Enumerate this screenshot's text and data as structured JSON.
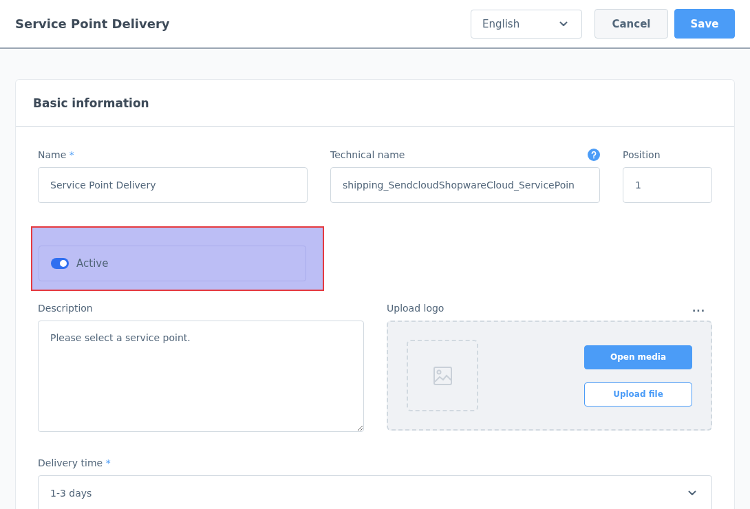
{
  "header": {
    "title": "Service Point Delivery",
    "language": "English",
    "buttons": [
      {
        "label": "Cancel",
        "kind": "secondary"
      },
      {
        "label": "Save",
        "kind": "primary"
      }
    ]
  },
  "card": {
    "title": "Basic information",
    "fields": [
      {
        "label": "Name",
        "required_mark": "*",
        "help": false,
        "value": "Service Point Delivery"
      },
      {
        "label": "Technical name",
        "help": true,
        "value": "shipping_SendcloudShopwareCloud_ServicePoin"
      },
      {
        "label": "Position",
        "help": false,
        "value": "1"
      }
    ],
    "active_switch": {
      "label": "Active",
      "on": true,
      "highlighted": true
    },
    "description": {
      "label": "Description",
      "value": "Please select a service point."
    },
    "upload": {
      "label": "Upload logo",
      "menu": "...",
      "buttons": [
        {
          "label": "Open media",
          "kind": "primary"
        },
        {
          "label": "Upload file",
          "kind": "outline"
        }
      ]
    },
    "delivery_time": {
      "label": "Delivery time",
      "required_mark": "*",
      "value": "1-3 days"
    }
  }
}
